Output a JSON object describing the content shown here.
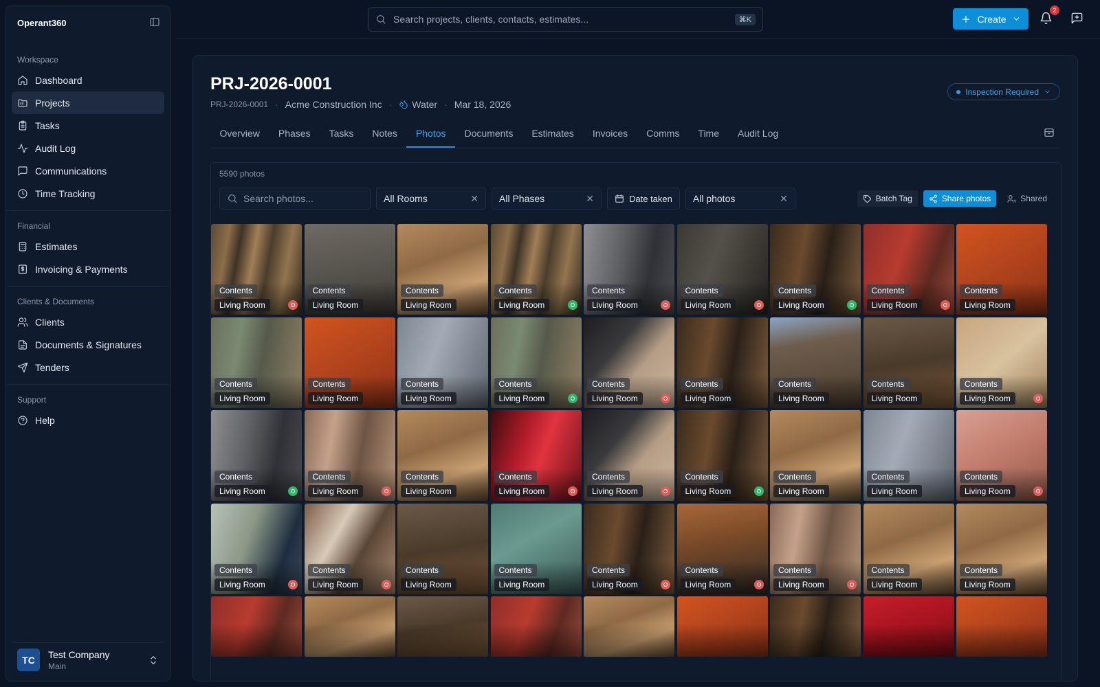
{
  "app": {
    "brand": "Operant360"
  },
  "sidebar": {
    "sections": [
      {
        "title": "Workspace",
        "items": [
          {
            "label": "Dashboard",
            "icon": "home-icon"
          },
          {
            "label": "Projects",
            "icon": "folder-icon",
            "active": true
          },
          {
            "label": "Tasks",
            "icon": "clipboard-icon"
          },
          {
            "label": "Audit Log",
            "icon": "activity-icon"
          },
          {
            "label": "Communications",
            "icon": "message-square-icon"
          },
          {
            "label": "Time Tracking",
            "icon": "clock-icon"
          }
        ]
      },
      {
        "title": "Financial",
        "items": [
          {
            "label": "Estimates",
            "icon": "calculator-icon"
          },
          {
            "label": "Invoicing & Payments",
            "icon": "receipt-icon"
          }
        ]
      },
      {
        "title": "Clients & Documents",
        "items": [
          {
            "label": "Clients",
            "icon": "users-icon"
          },
          {
            "label": "Documents & Signatures",
            "icon": "file-text-icon"
          },
          {
            "label": "Tenders",
            "icon": "send-icon"
          }
        ]
      },
      {
        "title": "Support",
        "items": [
          {
            "label": "Help",
            "icon": "help-circle-icon"
          }
        ]
      }
    ],
    "account": {
      "initials": "TC",
      "name": "Test Company",
      "sub": "Main"
    }
  },
  "topbar": {
    "search_placeholder": "Search projects, clients, contacts, estimates...",
    "shortcut": "⌘K",
    "create_label": "Create",
    "notification_count": "2"
  },
  "project": {
    "title": "PRJ-2026-0001",
    "meta": {
      "number": "PRJ-2026-0001",
      "client": "Acme Construction Inc",
      "loss_type": "Water",
      "date": "Mar 18, 2026"
    },
    "status": "Inspection Required",
    "tabs": [
      "Overview",
      "Phases",
      "Tasks",
      "Notes",
      "Photos",
      "Documents",
      "Estimates",
      "Invoices",
      "Comms",
      "Time",
      "Audit Log"
    ],
    "active_tab": "Photos"
  },
  "photos": {
    "count_text": "5590 photos",
    "search_placeholder": "Search photos...",
    "filters": {
      "rooms": "All Rooms",
      "phases": "All Phases",
      "date": "Date taken",
      "type": "All photos"
    },
    "actions": {
      "batch_tag": "Batch Tag",
      "share": "Share photos",
      "shared": "Shared"
    },
    "colors": {
      "accent": "#0d8ed8",
      "marker_red": "#e25b5b",
      "marker_green": "#2fb86b"
    },
    "tiles": [
      {
        "category": "Contents",
        "room": "Living Room",
        "marker": "red",
        "tone": "wood"
      },
      {
        "category": "Contents",
        "room": "Living Room",
        "marker": "",
        "tone": "concrete"
      },
      {
        "category": "Contents",
        "room": "Living Room",
        "marker": "",
        "tone": "lightwood"
      },
      {
        "category": "Contents",
        "room": "Living Room",
        "marker": "green",
        "tone": "wood"
      },
      {
        "category": "Contents",
        "room": "Living Room",
        "marker": "red",
        "tone": "grey"
      },
      {
        "category": "Contents",
        "room": "Living Room",
        "marker": "red",
        "tone": "dark"
      },
      {
        "category": "Contents",
        "room": "Living Room",
        "marker": "green",
        "tone": "darkwood"
      },
      {
        "category": "Contents",
        "room": "Living Room",
        "marker": "red",
        "tone": "redwall"
      },
      {
        "category": "Contents",
        "room": "Living Room",
        "marker": "",
        "tone": "orange"
      },
      {
        "category": "Contents",
        "room": "Living Room",
        "marker": "",
        "tone": "green"
      },
      {
        "category": "Contents",
        "room": "Living Room",
        "marker": "",
        "tone": "orange"
      },
      {
        "category": "Contents",
        "room": "Living Room",
        "marker": "",
        "tone": "slate"
      },
      {
        "category": "Contents",
        "room": "Living Room",
        "marker": "green",
        "tone": "green"
      },
      {
        "category": "Contents",
        "room": "Living Room",
        "marker": "red",
        "tone": "glove"
      },
      {
        "category": "Contents",
        "room": "Living Room",
        "marker": "",
        "tone": "darkwood"
      },
      {
        "category": "Contents",
        "room": "Living Room",
        "marker": "",
        "tone": "window"
      },
      {
        "category": "Contents",
        "room": "Living Room",
        "marker": "",
        "tone": "floor"
      },
      {
        "category": "Contents",
        "room": "Living Room",
        "marker": "red",
        "tone": "beige"
      },
      {
        "category": "Contents",
        "room": "Living Room",
        "marker": "green",
        "tone": "grey"
      },
      {
        "category": "Contents",
        "room": "Living Room",
        "marker": "red",
        "tone": "insulation"
      },
      {
        "category": "Contents",
        "room": "Living Room",
        "marker": "",
        "tone": "lightwood"
      },
      {
        "category": "Contents",
        "room": "Living Room",
        "marker": "red",
        "tone": "reddoor"
      },
      {
        "category": "Contents",
        "room": "Living Room",
        "marker": "red",
        "tone": "glove"
      },
      {
        "category": "Contents",
        "room": "Living Room",
        "marker": "green",
        "tone": "darkwood"
      },
      {
        "category": "Contents",
        "room": "Living Room",
        "marker": "",
        "tone": "lightwood"
      },
      {
        "category": "Contents",
        "room": "Living Room",
        "marker": "",
        "tone": "slate"
      },
      {
        "category": "Contents",
        "room": "Living Room",
        "marker": "red",
        "tone": "pink"
      },
      {
        "category": "Contents",
        "room": "Living Room",
        "marker": "red",
        "tone": "greenish"
      },
      {
        "category": "Contents",
        "room": "Living Room",
        "marker": "red",
        "tone": "clutter"
      },
      {
        "category": "Contents",
        "room": "Living Room",
        "marker": "",
        "tone": "floor"
      },
      {
        "category": "Contents",
        "room": "Living Room",
        "marker": "",
        "tone": "teal"
      },
      {
        "category": "Contents",
        "room": "Living Room",
        "marker": "red",
        "tone": "darkwood"
      },
      {
        "category": "Contents",
        "room": "Living Room",
        "marker": "red",
        "tone": "cabinet"
      },
      {
        "category": "Contents",
        "room": "Living Room",
        "marker": "red",
        "tone": "insulation"
      },
      {
        "category": "Contents",
        "room": "Living Room",
        "marker": "",
        "tone": "lightwood"
      },
      {
        "category": "Contents",
        "room": "Living Room",
        "marker": "",
        "tone": "lightwood"
      },
      {
        "category": "",
        "room": "",
        "marker": "",
        "tone": "redwall"
      },
      {
        "category": "",
        "room": "",
        "marker": "",
        "tone": "lightwood"
      },
      {
        "category": "",
        "room": "",
        "marker": "",
        "tone": "floor"
      },
      {
        "category": "",
        "room": "",
        "marker": "",
        "tone": "redwall"
      },
      {
        "category": "",
        "room": "",
        "marker": "",
        "tone": "lightwood"
      },
      {
        "category": "",
        "room": "",
        "marker": "",
        "tone": "orange"
      },
      {
        "category": "",
        "room": "",
        "marker": "",
        "tone": "darkwood"
      },
      {
        "category": "",
        "room": "",
        "marker": "",
        "tone": "red"
      },
      {
        "category": "",
        "room": "",
        "marker": "",
        "tone": "orange"
      }
    ]
  }
}
